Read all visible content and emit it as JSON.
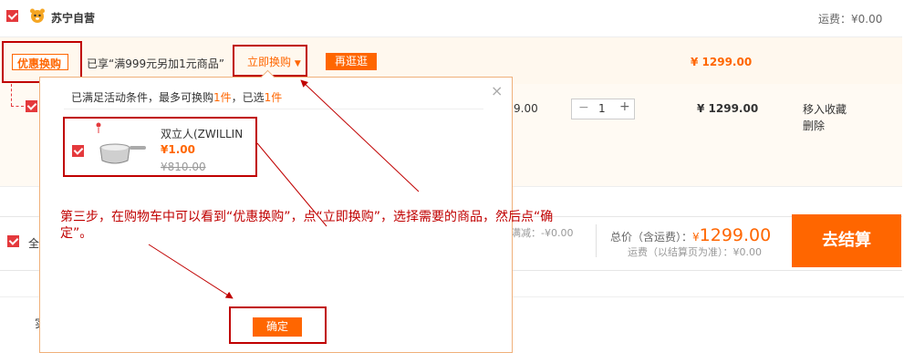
{
  "header": {
    "store_name": "苏宁自营",
    "shipping": "运费：¥0.00"
  },
  "promo": {
    "tag": "优惠换购",
    "desc": "已享“满999元另加1元商品”",
    "exchange_link": "立即换购",
    "more_button": "再逛逛",
    "subtotal": "¥ 1299.00"
  },
  "product": {
    "price_partial": "9.00",
    "quantity": "1",
    "minus": "−",
    "plus": "+",
    "total": "¥ 1299.00",
    "favorite": "移入收藏",
    "delete": "删除"
  },
  "popup": {
    "info_prefix": "已满足活动条件，最多可换购",
    "info_max": "1件",
    "info_mid": "，已选",
    "info_sel": "1件",
    "close": "×",
    "item_name": "双立人(ZWILLIN",
    "item_price": "¥1.00",
    "item_orig_price": "¥810.00",
    "confirm": "确定"
  },
  "footer": {
    "select_all_partial": "全",
    "discount_partial": "满减：-¥0.00",
    "total_label": "总价（含运费）：",
    "total_currency": "¥",
    "total_value": "1299.00",
    "shipping_note": "运费（以结算页为准）：¥0.00",
    "checkout": "去结算",
    "partial_char": "实"
  },
  "annotation": {
    "text": "第三步，在购物车中可以看到“优惠换购”，点“立即换购”，选择需要的商品，然后点“确定”。"
  },
  "colors": {
    "accent": "#ff6600",
    "promo_bg": "#fff8ee",
    "annotation": "#c00000",
    "checkbox": "#e4393c"
  }
}
